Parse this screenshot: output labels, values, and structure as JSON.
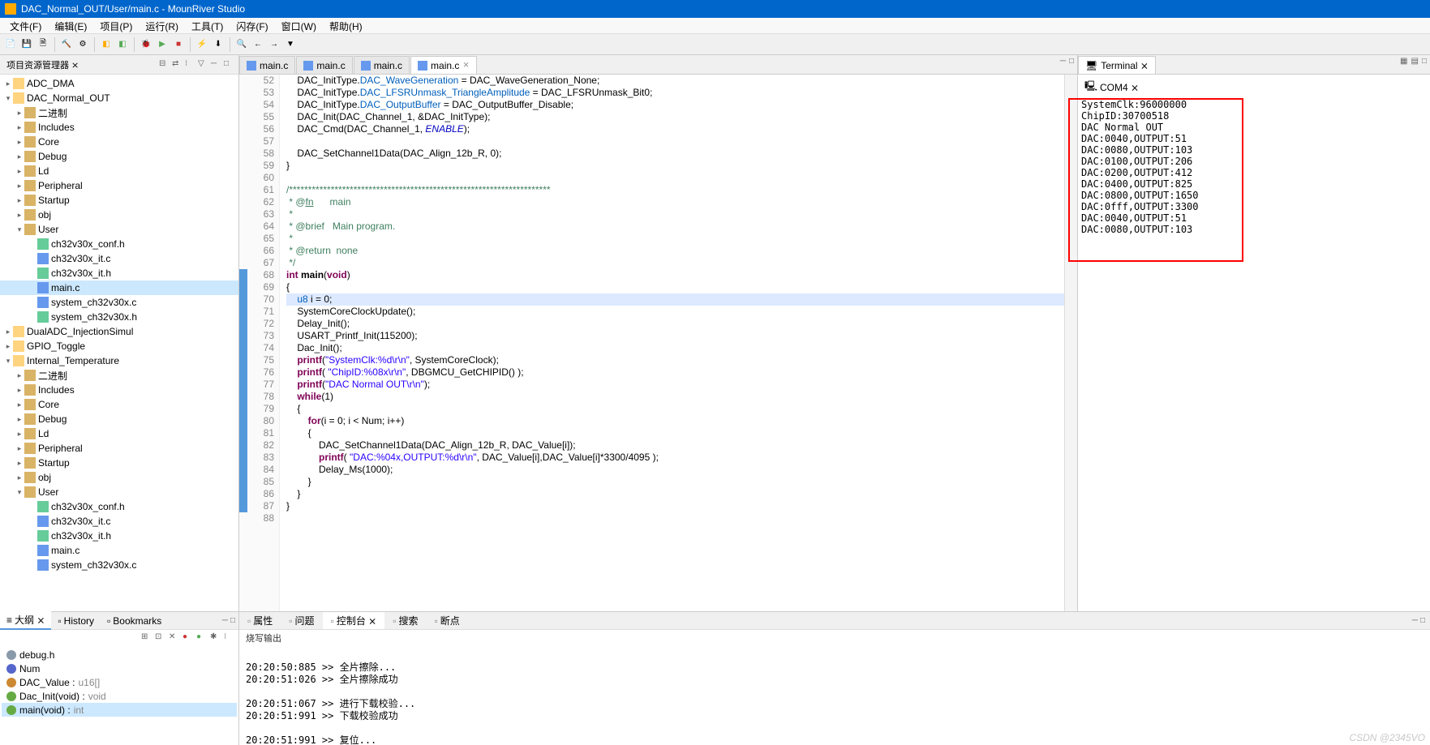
{
  "titlebar": {
    "text": "DAC_Normal_OUT/User/main.c - MounRiver Studio"
  },
  "menus": [
    "文件(F)",
    "编辑(E)",
    "项目(P)",
    "运行(R)",
    "工具(T)",
    "闪存(F)",
    "窗口(W)",
    "帮助(H)"
  ],
  "project_tree": {
    "title": "项目资源管理器 ⨯",
    "nodes": [
      {
        "lvl": 0,
        "exp": "▸",
        "ico": "proj",
        "label": "ADC_DMA"
      },
      {
        "lvl": 0,
        "exp": "▾",
        "ico": "proj",
        "label": "DAC_Normal_OUT"
      },
      {
        "lvl": 1,
        "exp": "▸",
        "ico": "fold",
        "label": "二进制"
      },
      {
        "lvl": 1,
        "exp": "▸",
        "ico": "fold",
        "label": "Includes"
      },
      {
        "lvl": 1,
        "exp": "▸",
        "ico": "fold",
        "label": "Core"
      },
      {
        "lvl": 1,
        "exp": "▸",
        "ico": "fold",
        "label": "Debug"
      },
      {
        "lvl": 1,
        "exp": "▸",
        "ico": "fold",
        "label": "Ld"
      },
      {
        "lvl": 1,
        "exp": "▸",
        "ico": "fold",
        "label": "Peripheral"
      },
      {
        "lvl": 1,
        "exp": "▸",
        "ico": "fold",
        "label": "Startup"
      },
      {
        "lvl": 1,
        "exp": "▸",
        "ico": "fold",
        "label": "obj"
      },
      {
        "lvl": 1,
        "exp": "▾",
        "ico": "fold",
        "label": "User"
      },
      {
        "lvl": 2,
        "exp": " ",
        "ico": "h",
        "label": "ch32v30x_conf.h"
      },
      {
        "lvl": 2,
        "exp": " ",
        "ico": "c",
        "label": "ch32v30x_it.c"
      },
      {
        "lvl": 2,
        "exp": " ",
        "ico": "h",
        "label": "ch32v30x_it.h"
      },
      {
        "lvl": 2,
        "exp": " ",
        "ico": "c",
        "label": "main.c",
        "selected": true
      },
      {
        "lvl": 2,
        "exp": " ",
        "ico": "c",
        "label": "system_ch32v30x.c"
      },
      {
        "lvl": 2,
        "exp": " ",
        "ico": "h",
        "label": "system_ch32v30x.h"
      },
      {
        "lvl": 0,
        "exp": "▸",
        "ico": "proj",
        "label": "DualADC_InjectionSimul"
      },
      {
        "lvl": 0,
        "exp": "▸",
        "ico": "proj",
        "label": "GPIO_Toggle"
      },
      {
        "lvl": 0,
        "exp": "▾",
        "ico": "proj",
        "label": "Internal_Temperature"
      },
      {
        "lvl": 1,
        "exp": "▸",
        "ico": "fold",
        "label": "二进制"
      },
      {
        "lvl": 1,
        "exp": "▸",
        "ico": "fold",
        "label": "Includes"
      },
      {
        "lvl": 1,
        "exp": "▸",
        "ico": "fold",
        "label": "Core"
      },
      {
        "lvl": 1,
        "exp": "▸",
        "ico": "fold",
        "label": "Debug"
      },
      {
        "lvl": 1,
        "exp": "▸",
        "ico": "fold",
        "label": "Ld"
      },
      {
        "lvl": 1,
        "exp": "▸",
        "ico": "fold",
        "label": "Peripheral"
      },
      {
        "lvl": 1,
        "exp": "▸",
        "ico": "fold",
        "label": "Startup"
      },
      {
        "lvl": 1,
        "exp": "▸",
        "ico": "fold",
        "label": "obj"
      },
      {
        "lvl": 1,
        "exp": "▾",
        "ico": "fold",
        "label": "User"
      },
      {
        "lvl": 2,
        "exp": " ",
        "ico": "h",
        "label": "ch32v30x_conf.h"
      },
      {
        "lvl": 2,
        "exp": " ",
        "ico": "c",
        "label": "ch32v30x_it.c"
      },
      {
        "lvl": 2,
        "exp": " ",
        "ico": "h",
        "label": "ch32v30x_it.h"
      },
      {
        "lvl": 2,
        "exp": " ",
        "ico": "c",
        "label": "main.c"
      },
      {
        "lvl": 2,
        "exp": " ",
        "ico": "c",
        "label": "system_ch32v30x.c"
      }
    ]
  },
  "editor_tabs": [
    {
      "label": "main.c",
      "active": false
    },
    {
      "label": "main.c",
      "active": false
    },
    {
      "label": "main.c",
      "active": false
    },
    {
      "label": "main.c",
      "active": true
    }
  ],
  "code_lines": [
    {
      "n": 52,
      "html": "    DAC_InitType.<span class='typ'>DAC_WaveGeneration</span> = DAC_WaveGeneration_None;"
    },
    {
      "n": 53,
      "html": "    DAC_InitType.<span class='typ'>DAC_LFSRUnmask_TriangleAmplitude</span> = DAC_LFSRUnmask_Bit0;"
    },
    {
      "n": 54,
      "html": "    DAC_InitType.<span class='typ'>DAC_OutputBuffer</span> = DAC_OutputBuffer_Disable;"
    },
    {
      "n": 55,
      "html": "    DAC_Init(DAC_Channel_1, &DAC_InitType);"
    },
    {
      "n": 56,
      "html": "    DAC_Cmd(DAC_Channel_1, <span class='mac'>ENABLE</span>);"
    },
    {
      "n": 57,
      "html": ""
    },
    {
      "n": 58,
      "html": "    DAC_SetChannel1Data(DAC_Align_12b_R, 0);"
    },
    {
      "n": 59,
      "html": "}"
    },
    {
      "n": 60,
      "html": ""
    },
    {
      "n": 61,
      "html": "<span class='cmt'>/*********************************************************************</span>"
    },
    {
      "n": 62,
      "html": "<span class='cmt'> * @<u>fn</u>      main</span>"
    },
    {
      "n": 63,
      "html": "<span class='cmt'> *</span>"
    },
    {
      "n": 64,
      "html": "<span class='cmt'> * @brief   Main program.</span>"
    },
    {
      "n": 65,
      "html": "<span class='cmt'> *</span>"
    },
    {
      "n": 66,
      "html": "<span class='cmt'> * @return  none</span>"
    },
    {
      "n": 67,
      "html": "<span class='cmt'> */</span>"
    },
    {
      "n": 68,
      "html": "<span class='kw'>int</span> <span class='fn'><b>main</b></span>(<span class='kw'>void</span>)",
      "mark": true
    },
    {
      "n": 69,
      "html": "{",
      "mark": true
    },
    {
      "n": 70,
      "html": "    <span class='typ'>u8</span> i = 0;",
      "mark": true,
      "hl": true
    },
    {
      "n": 71,
      "html": "    SystemCoreClockUpdate();",
      "mark": true
    },
    {
      "n": 72,
      "html": "    Delay_Init();",
      "mark": true
    },
    {
      "n": 73,
      "html": "    USART_Printf_Init(115200);",
      "mark": true
    },
    {
      "n": 74,
      "html": "    Dac_Init();",
      "mark": true
    },
    {
      "n": 75,
      "html": "    <span class='kw'>printf</span>(<span class='str'>\"SystemClk:%d\\r\\n\"</span>, SystemCoreClock);",
      "mark": true
    },
    {
      "n": 76,
      "html": "    <span class='kw'>printf</span>( <span class='str'>\"ChipID:%08x\\r\\n\"</span>, DBGMCU_GetCHIPID() );",
      "mark": true
    },
    {
      "n": 77,
      "html": "    <span class='kw'>printf</span>(<span class='str'>\"DAC Normal OUT\\r\\n\"</span>);",
      "mark": true
    },
    {
      "n": 78,
      "html": "    <span class='kw'>while</span>(1)",
      "mark": true
    },
    {
      "n": 79,
      "html": "    {",
      "mark": true
    },
    {
      "n": 80,
      "html": "        <span class='kw'>for</span>(i = 0; i < Num; i++)",
      "mark": true
    },
    {
      "n": 81,
      "html": "        {",
      "mark": true
    },
    {
      "n": 82,
      "html": "            DAC_SetChannel1Data(DAC_Align_12b_R, DAC_Value[i]);",
      "mark": true
    },
    {
      "n": 83,
      "html": "            <span class='kw'>printf</span>( <span class='str'>\"DAC:%04x,OUTPUT:%d\\r\\n\"</span>, DAC_Value[i],DAC_Value[i]*3300/4095 );",
      "mark": true
    },
    {
      "n": 84,
      "html": "            Delay_Ms(1000);",
      "mark": true
    },
    {
      "n": 85,
      "html": "        }",
      "mark": true
    },
    {
      "n": 86,
      "html": "    }",
      "mark": true
    },
    {
      "n": 87,
      "html": "}",
      "mark": true
    },
    {
      "n": 88,
      "html": ""
    }
  ],
  "terminal": {
    "tab_title": "Terminal ⨯",
    "port": "COM4 ⨯",
    "lines": [
      "SystemClk:96000000",
      "ChipID:30700518",
      "DAC Normal OUT",
      "DAC:0040,OUTPUT:51",
      "DAC:0080,OUTPUT:103",
      "DAC:0100,OUTPUT:206",
      "DAC:0200,OUTPUT:412",
      "DAC:0400,OUTPUT:825",
      "DAC:0800,OUTPUT:1650",
      "DAC:0fff,OUTPUT:3300",
      "DAC:0040,OUTPUT:51",
      "DAC:0080,OUTPUT:103"
    ]
  },
  "outline": {
    "tabs": [
      "大纲 ⨯",
      "History",
      "Bookmarks"
    ],
    "items": [
      {
        "ico": "inc",
        "label": "debug.h"
      },
      {
        "ico": "var",
        "label": "Num"
      },
      {
        "ico": "arr",
        "label": "DAC_Value : ",
        "dim": "u16[]"
      },
      {
        "ico": "fn",
        "label": "Dac_Init(void) : ",
        "dim": "void"
      },
      {
        "ico": "fn",
        "label": "main(void) : ",
        "dim": "int",
        "selected": true
      }
    ]
  },
  "bottom_right": {
    "tabs": [
      "属性",
      "问题",
      "控制台 ⨯",
      "搜索",
      "断点"
    ],
    "header": "烧写输出",
    "lines": [
      "",
      "20:20:50:885 >> 全片擦除...",
      "20:20:51:026 >> 全片擦除成功",
      "",
      "20:20:51:067 >> 进行下载校验...",
      "20:20:51:991 >> 下载校验成功",
      "",
      "20:20:51:991 >> 复位..."
    ]
  },
  "watermark": "CSDN @2345VO"
}
